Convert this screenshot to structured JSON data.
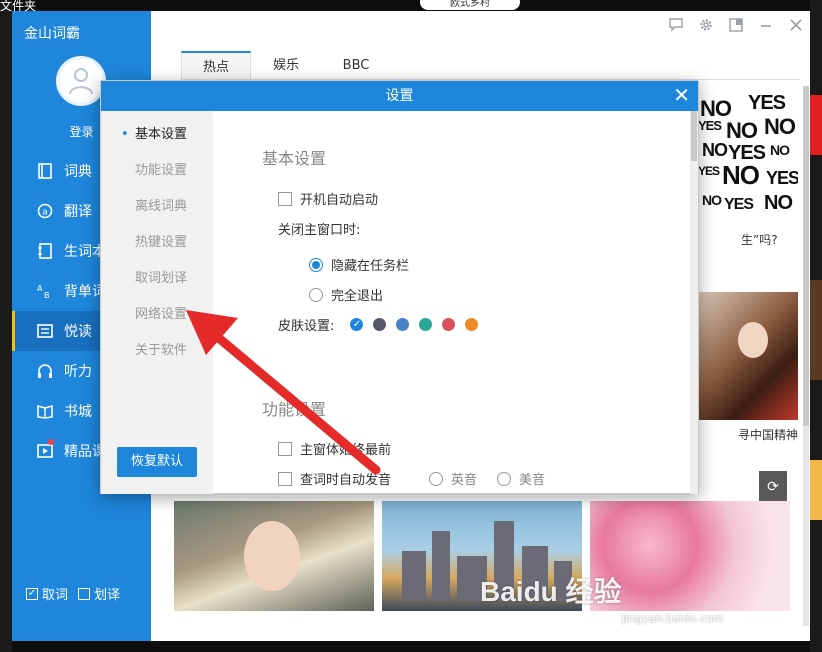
{
  "desktop": {
    "title": "文件夹",
    "top_tab": "欧式乡村"
  },
  "sidebar": {
    "app_name": "金山词霸",
    "login": "登录",
    "items": [
      {
        "label": "词典",
        "icon": "book-icon"
      },
      {
        "label": "翻译",
        "icon": "translate-icon"
      },
      {
        "label": "生词本",
        "icon": "notebook-icon"
      },
      {
        "label": "背单词",
        "icon": "ab-icon"
      },
      {
        "label": "悦读",
        "icon": "reading-icon",
        "active": true
      },
      {
        "label": "听力",
        "icon": "headphones-icon"
      },
      {
        "label": "书城",
        "icon": "open-book-icon"
      },
      {
        "label": "精品课",
        "icon": "video-course-icon"
      }
    ],
    "bottom": {
      "lookup": "取词",
      "select": "划译"
    }
  },
  "main": {
    "tabs": [
      "热点",
      "娱乐",
      "BBC"
    ],
    "captions": {
      "c1": "生”吗?",
      "c2": "寻中国精神"
    }
  },
  "dialog": {
    "title": "设置",
    "nav": [
      "基本设置",
      "功能设置",
      "离线词典",
      "热键设置",
      "取词划译",
      "网络设置",
      "关于软件"
    ],
    "restore_btn": "恢复默认",
    "basic": {
      "title": "基本设置",
      "autostart": "开机自动启动",
      "close_label": "关闭主窗口时:",
      "hide_tray": "隐藏在任务栏",
      "exit": "完全退出",
      "skin_label": "皮肤设置:",
      "skins": [
        "#1e86db",
        "#555a66",
        "#4a80c8",
        "#2aa89a",
        "#d9505f",
        "#f08a24"
      ]
    },
    "function": {
      "title": "功能设置",
      "always_top": "主窗体始终最前",
      "auto_pronounce": "查词时自动发音",
      "uk": "英音",
      "us": "美音"
    }
  },
  "watermark": {
    "brand": "Baidu 经验",
    "url": "jingyan.baidu.com"
  }
}
